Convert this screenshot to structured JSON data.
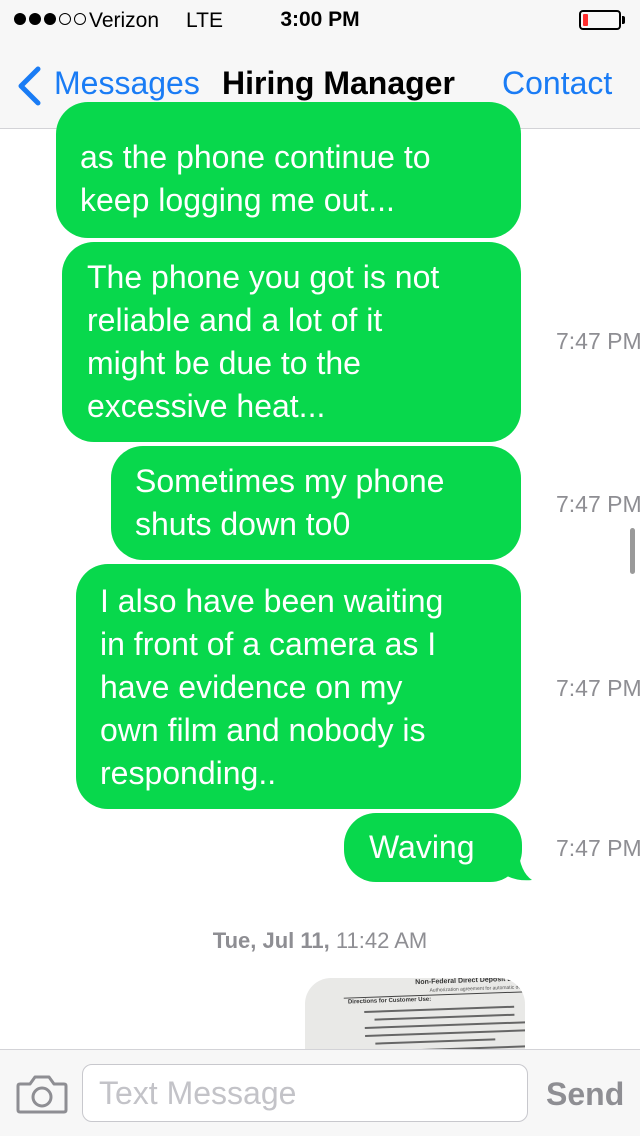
{
  "status_bar": {
    "carrier": "Verizon",
    "network": "LTE",
    "time": "3:00 PM",
    "signal_bars_filled": 3,
    "signal_bars_total": 5,
    "battery_level": 0.15,
    "battery_color": "#ff2d2d"
  },
  "nav": {
    "back_label": "Messages",
    "title": "Hiring Manager",
    "contact_label": "Contact",
    "accent_color": "#1a7cf5"
  },
  "conversation": {
    "bubble_color": "#08d84c",
    "messages": [
      {
        "lines": [
          "as the phone continue to",
          "keep logging me out..."
        ],
        "time": ""
      },
      {
        "lines": [
          "The phone you got is not",
          "reliable and a lot of it",
          "might be due to the",
          "excessive heat..."
        ],
        "time": "7:47 PM"
      },
      {
        "lines": [
          "Sometimes my phone",
          "shuts down to0"
        ],
        "time": "7:47 PM"
      },
      {
        "lines": [
          "I also have been waiting",
          "in front of a camera as I",
          "have evidence on my",
          "own film and nobody is",
          "responding.."
        ],
        "time": "7:47 PM"
      },
      {
        "lines": [
          "Waving"
        ],
        "time": "7:47 PM"
      }
    ],
    "date_header": {
      "day": "Tue, Jul 11,",
      "time": "11:42 AM"
    },
    "attachment": {
      "icon": "document-image-thumbnail",
      "title": "Non-Federal Direct Deposit Enrollment Request",
      "subtitle": "Authorization agreement for automatic deposits (ACH credits)",
      "section": "Directions for Customer Use:"
    }
  },
  "input_bar": {
    "camera_icon": "camera-icon",
    "placeholder": "Text Message",
    "value": "",
    "send_label": "Send"
  }
}
